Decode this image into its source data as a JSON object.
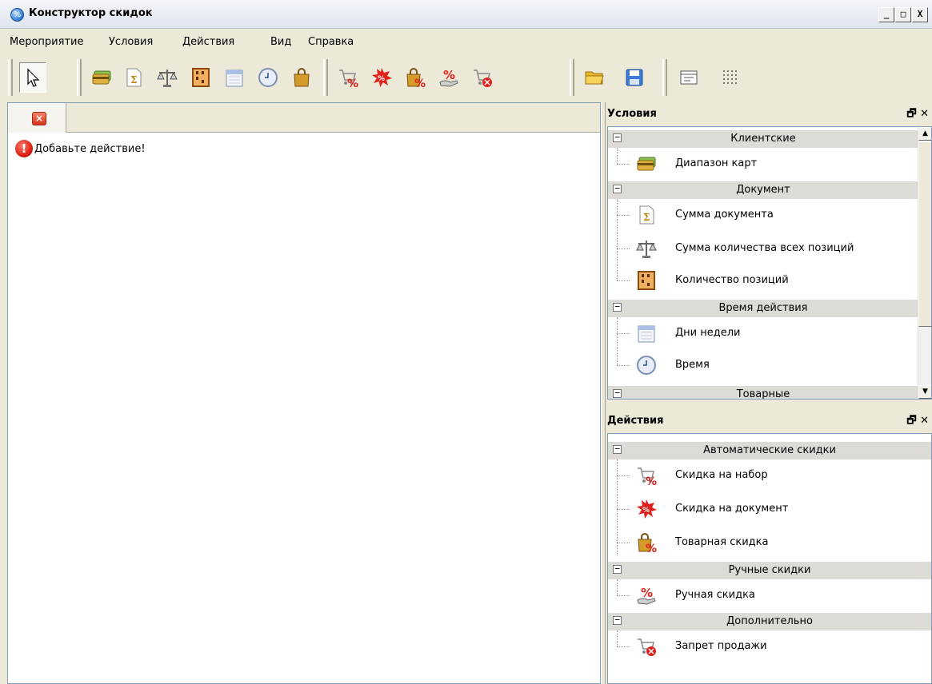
{
  "window": {
    "title": "Конструктор скидок",
    "min_label": "_",
    "max_label": "□",
    "close_label": "X"
  },
  "menu": [
    "Мероприятие",
    "Условия",
    "Действия",
    "Вид",
    "Справка"
  ],
  "toolbar": {
    "buttons": [
      "pointer-icon",
      "card-range-icon",
      "document-sum-icon",
      "scales-icon",
      "abacus-icon",
      "calendar-icon",
      "clock-icon",
      "shopping-bag-icon",
      "cart-percent-icon",
      "percent-burst-icon",
      "bag-percent-icon",
      "hand-percent-icon",
      "cart-forbid-icon",
      "open-folder-icon",
      "save-disk-icon",
      "window-layout-icon",
      "grid-dots-icon"
    ]
  },
  "editor": {
    "message": "Добавьте действие!"
  },
  "conditions_panel": {
    "title": "Условия",
    "pin_glyph": "🗗",
    "close_glyph": "✕",
    "groups": [
      {
        "label": "Клиентские",
        "items": [
          {
            "label": "Диапазон карт",
            "icon": "card-range-icon"
          }
        ]
      },
      {
        "label": "Документ",
        "items": [
          {
            "label": "Сумма документа",
            "icon": "document-sum-icon"
          },
          {
            "label": "Сумма количества всех позиций",
            "icon": "scales-icon"
          },
          {
            "label": "Количество позиций",
            "icon": "abacus-icon"
          }
        ]
      },
      {
        "label": "Время действия",
        "items": [
          {
            "label": "Дни недели",
            "icon": "calendar-icon"
          },
          {
            "label": "Время",
            "icon": "clock-icon"
          }
        ]
      },
      {
        "label": "Товарные",
        "items": []
      }
    ]
  },
  "actions_panel": {
    "title": "Действия",
    "pin_glyph": "🗗",
    "close_glyph": "✕",
    "groups": [
      {
        "label": "Автоматические скидки",
        "items": [
          {
            "label": "Скидка на набор",
            "icon": "cart-percent-icon"
          },
          {
            "label": "Скидка на документ",
            "icon": "percent-burst-icon"
          },
          {
            "label": "Товарная скидка",
            "icon": "bag-percent-icon"
          }
        ]
      },
      {
        "label": "Ручные скидки",
        "items": [
          {
            "label": "Ручная скидка",
            "icon": "hand-percent-icon"
          }
        ]
      },
      {
        "label": "Дополнительно",
        "items": [
          {
            "label": "Запрет продажи",
            "icon": "cart-forbid-icon"
          }
        ]
      }
    ]
  },
  "colors": {
    "accent_red": "#d9190f",
    "group_bg": "#dcdbd6",
    "chrome": "#ece9d8"
  }
}
